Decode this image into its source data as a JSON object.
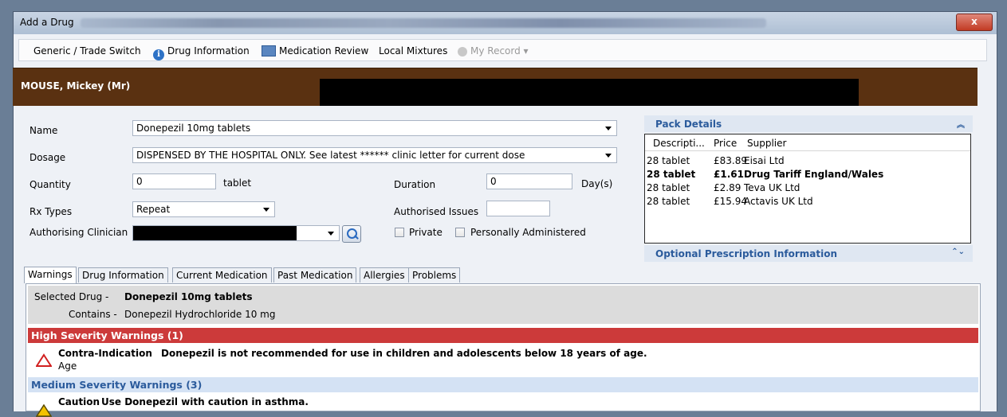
{
  "window": {
    "title": "Add a Drug",
    "close_label": "x"
  },
  "toolbar": {
    "generic_trade": "Generic / Trade Switch",
    "drug_information": "Drug Information",
    "medication_review": "Medication Review",
    "local_mixtures": "Local Mixtures",
    "my_record": "My Record ▾"
  },
  "patient": {
    "name": "MOUSE, Mickey (Mr)"
  },
  "form": {
    "name_label": "Name",
    "name_value": "Donepezil 10mg tablets",
    "dosage_label": "Dosage",
    "dosage_value": "DISPENSED BY THE HOSPITAL ONLY. See latest ****** clinic letter for current dose",
    "quantity_label": "Quantity",
    "quantity_value": "0",
    "quantity_unit": "tablet",
    "duration_label": "Duration",
    "duration_value": "0",
    "duration_unit": "Day(s)",
    "rx_types_label": "Rx Types",
    "rx_types_value": "Repeat",
    "authorised_issues_label": "Authorised Issues",
    "authorised_issues_value": "",
    "authorising_clinician_label": "Authorising Clinician",
    "private_label": "Private",
    "personally_administered_label": "Personally Administered"
  },
  "pack_details": {
    "title": "Pack Details",
    "columns": [
      "Descripti...",
      "Price",
      "Supplier"
    ],
    "rows": [
      {
        "desc": "28 tablet",
        "price": "£83.89",
        "supplier": "Eisai Ltd",
        "bold": false
      },
      {
        "desc": "28 tablet",
        "price": "£1.61",
        "supplier": "Drug Tariff England/Wales",
        "bold": true
      },
      {
        "desc": "28 tablet",
        "price": "£2.89",
        "supplier": "Teva UK Ltd",
        "bold": false
      },
      {
        "desc": "28 tablet",
        "price": "£15.94",
        "supplier": "Actavis UK Ltd",
        "bold": false
      }
    ]
  },
  "optional_info": {
    "title": "Optional Prescription Information"
  },
  "tabs": [
    "Warnings",
    "Drug Information",
    "Current Medication",
    "Past Medication",
    "Allergies",
    "Problems"
  ],
  "warnings": {
    "selected_label": "Selected Drug -",
    "selected_value": "Donepezil 10mg tablets",
    "contains_label": "Contains -",
    "contains_value": "Donepezil Hydrochloride 10 mg",
    "high_header": "High Severity Warnings (1)",
    "high_item_type": "Contra-Indication",
    "high_item_text": "Donepezil is not recommended for use in children and adolescents below 18 years of age.",
    "high_item_sub": "Age",
    "medium_header": "Medium Severity Warnings (3)",
    "medium_item_type": "Caution",
    "medium_item_text": "Use Donepezil with caution in asthma."
  }
}
